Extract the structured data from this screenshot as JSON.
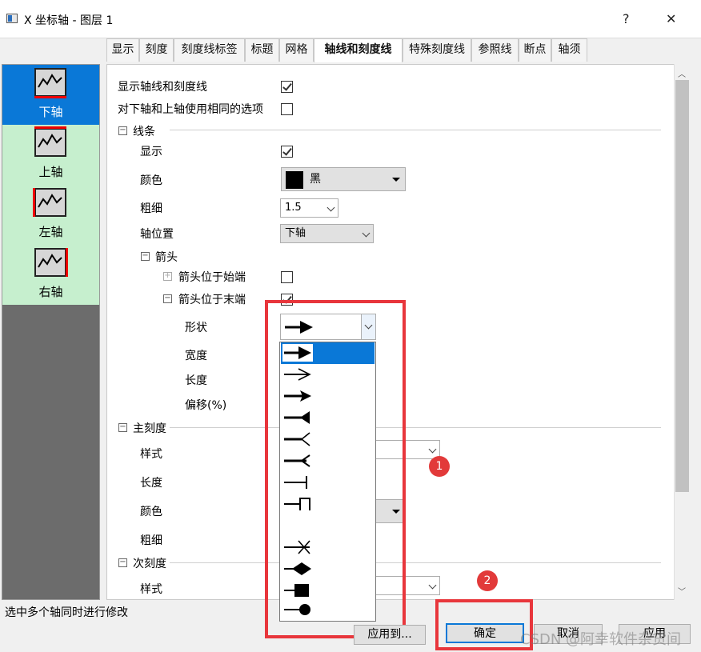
{
  "window": {
    "title": "X 坐标轴 - 图层 1",
    "help": "?",
    "close": "✕"
  },
  "tabs": [
    {
      "label": "显示"
    },
    {
      "label": "刻度"
    },
    {
      "label": "刻度线标签"
    },
    {
      "label": "标题"
    },
    {
      "label": "网格"
    },
    {
      "label": "轴线和刻度线",
      "active": true
    },
    {
      "label": "特殊刻度线"
    },
    {
      "label": "参照线"
    },
    {
      "label": "断点"
    },
    {
      "label": "轴须"
    }
  ],
  "axes": [
    {
      "label": "下轴",
      "selected": true
    },
    {
      "label": "上轴"
    },
    {
      "label": "左轴"
    },
    {
      "label": "右轴"
    }
  ],
  "options": {
    "show_axis": "显示轴线和刻度线",
    "same_options": "对下轴和上轴使用相同的选项",
    "line_section": "线条",
    "show": "显示",
    "color": "颜色",
    "color_value": "黑",
    "thickness": "粗细",
    "thickness_value": "1.5",
    "axis_position": "轴位置",
    "axis_position_value": "下轴",
    "arrow_section": "箭头",
    "arrow_start": "箭头位于始端",
    "arrow_end": "箭头位于末端",
    "shape": "形状",
    "width": "宽度",
    "length": "长度",
    "offset": "偏移(%)",
    "major_section": "主刻度",
    "style": "样式",
    "major_length": "长度",
    "major_color": "颜色",
    "major_thickness": "粗细",
    "minor_section": "次刻度",
    "minor_style": "样式"
  },
  "shape_options": [
    "filled-arrow",
    "open-arrow",
    "arrow",
    "notched-arrow",
    "fork",
    "fork-barb",
    "tee",
    "bracket",
    "cross",
    "diamond",
    "square",
    "circle"
  ],
  "badges": [
    "1",
    "2"
  ],
  "buttons": {
    "apply_to": "应用到...",
    "ok": "确定",
    "cancel": "取消",
    "apply": "应用"
  },
  "status": "选中多个轴同时进行修改",
  "watermark": "CSDN @阿幸软件杂货间",
  "colors": {
    "accent": "#0a78d7",
    "highlight_red": "#e8363c",
    "axis_green": "#c6efce"
  }
}
